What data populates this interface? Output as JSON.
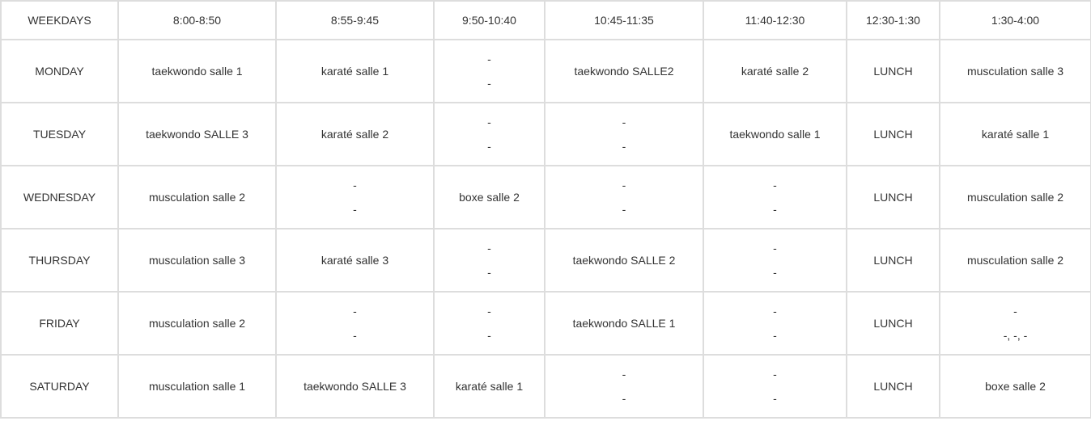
{
  "columns": [
    "WEEKDAYS",
    "8:00-8:50",
    "8:55-9:45",
    "9:50-10:40",
    "10:45-11:35",
    "11:40-12:30",
    "12:30-1:30",
    "1:30-4:00"
  ],
  "rows": [
    {
      "day": "MONDAY",
      "cells": [
        [
          "taekwondo  salle 1"
        ],
        [
          "karaté salle 1"
        ],
        [
          "-",
          "-"
        ],
        [
          "taekwondo SALLE2"
        ],
        [
          "karaté salle 2"
        ],
        [
          "LUNCH"
        ],
        [
          "musculation salle 3"
        ]
      ]
    },
    {
      "day": "TUESDAY",
      "cells": [
        [
          "taekwondo SALLE 3"
        ],
        [
          "karaté salle 2"
        ],
        [
          "-",
          "-"
        ],
        [
          "-",
          "-"
        ],
        [
          "taekwondo salle 1"
        ],
        [
          "LUNCH"
        ],
        [
          "karaté salle 1"
        ]
      ]
    },
    {
      "day": "WEDNESDAY",
      "cells": [
        [
          "musculation salle 2"
        ],
        [
          "-",
          "-"
        ],
        [
          "boxe salle 2"
        ],
        [
          "-",
          "-"
        ],
        [
          "-",
          "-"
        ],
        [
          "LUNCH"
        ],
        [
          "musculation salle 2"
        ]
      ]
    },
    {
      "day": "THURSDAY",
      "cells": [
        [
          "musculation salle 3"
        ],
        [
          "karaté salle 3"
        ],
        [
          "-",
          "-"
        ],
        [
          "taekwondo SALLE 2"
        ],
        [
          "-",
          "-"
        ],
        [
          "LUNCH"
        ],
        [
          "musculation salle 2"
        ]
      ]
    },
    {
      "day": "FRIDAY",
      "cells": [
        [
          "musculation salle 2"
        ],
        [
          "-",
          "-"
        ],
        [
          "-",
          "-"
        ],
        [
          "taekwondo SALLE 1"
        ],
        [
          "-",
          "-"
        ],
        [
          "LUNCH"
        ],
        [
          "-",
          "-, -, -"
        ]
      ]
    },
    {
      "day": "SATURDAY",
      "cells": [
        [
          "musculation salle 1"
        ],
        [
          "taekwondo SALLE 3"
        ],
        [
          "karaté salle 1"
        ],
        [
          "-",
          "-"
        ],
        [
          "-",
          "-"
        ],
        [
          "LUNCH"
        ],
        [
          "boxe salle 2"
        ]
      ]
    }
  ]
}
